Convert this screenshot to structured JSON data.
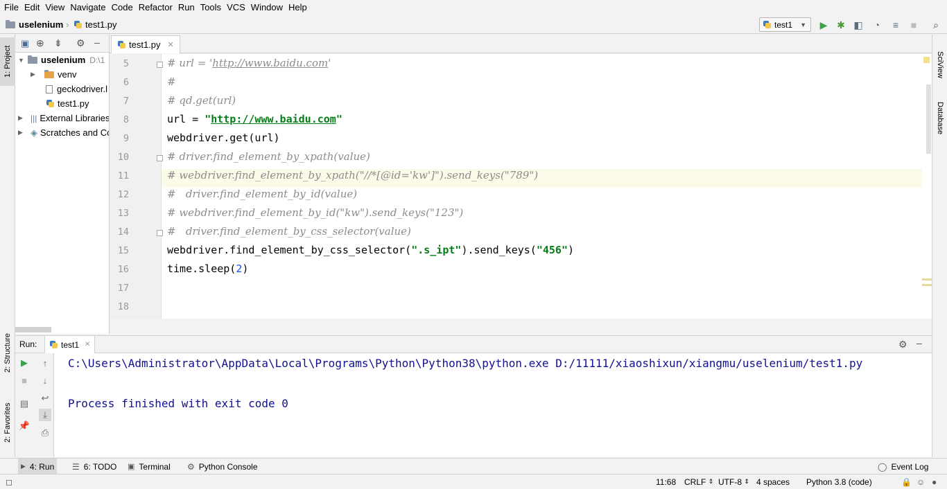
{
  "menu": [
    "File",
    "Edit",
    "View",
    "Navigate",
    "Code",
    "Refactor",
    "Run",
    "Tools",
    "VCS",
    "Window",
    "Help"
  ],
  "breadcrumb": {
    "project": "uselenium",
    "file": "test1.py"
  },
  "run_config": {
    "name": "test1"
  },
  "left_tabs": {
    "project": "1: Project",
    "structure": "2: Structure",
    "favorites": "2: Favorites"
  },
  "right_tabs": {
    "sciview": "SciView",
    "database": "Database"
  },
  "project_tree": {
    "root": "uselenium",
    "root_path": "D:\\1",
    "items": [
      {
        "label": "venv"
      },
      {
        "label": "geckodriver.l"
      },
      {
        "label": "test1.py"
      },
      {
        "label": "External Libraries"
      },
      {
        "label": "Scratches and Co"
      }
    ]
  },
  "editor": {
    "tab": "test1.py",
    "lines": [
      {
        "n": "5",
        "parts": [
          [
            "cmt",
            "# url = '"
          ],
          [
            "cmt-url",
            "http://www.baidu.com"
          ],
          [
            "cmt",
            "'"
          ]
        ]
      },
      {
        "n": "6",
        "parts": [
          [
            "cmt",
            "#"
          ]
        ]
      },
      {
        "n": "7",
        "parts": [
          [
            "cmt",
            "# qd.get(url)"
          ]
        ]
      },
      {
        "n": "8",
        "parts": [
          [
            "",
            "url = "
          ],
          [
            "str",
            "\""
          ],
          [
            "url",
            "http://www.baidu.com"
          ],
          [
            "str",
            "\""
          ]
        ]
      },
      {
        "n": "9",
        "parts": [
          [
            "",
            "webdriver.get(url)"
          ]
        ]
      },
      {
        "n": "10",
        "parts": [
          [
            "cmt",
            "# driver.find_element_by_xpath(value)"
          ]
        ]
      },
      {
        "n": "11",
        "parts": [
          [
            "cmt",
            "# webdriver.find_element_by_xpath(\"//*[@id='kw']\").send_keys(\"789\")"
          ]
        ]
      },
      {
        "n": "12",
        "parts": [
          [
            "cmt",
            "#   driver.find_element_by_id(value)"
          ]
        ]
      },
      {
        "n": "13",
        "parts": [
          [
            "cmt",
            "# webdriver.find_element_by_id(\"kw\").send_keys(\"123\")"
          ]
        ]
      },
      {
        "n": "14",
        "parts": [
          [
            "cmt",
            "#   driver.find_element_by_css_selector(value)"
          ]
        ]
      },
      {
        "n": "15",
        "parts": [
          [
            "",
            "webdriver.find_element_by_css_selector("
          ],
          [
            "str",
            "\".s_ipt\""
          ],
          [
            "",
            ").send_keys("
          ],
          [
            "str",
            "\"456\""
          ],
          [
            "",
            ")"
          ]
        ]
      },
      {
        "n": "16",
        "parts": [
          [
            "",
            "time.sleep("
          ],
          [
            "num",
            "2"
          ],
          [
            "",
            ")"
          ]
        ]
      },
      {
        "n": "17",
        "parts": []
      },
      {
        "n": "18",
        "parts": []
      }
    ]
  },
  "run_panel": {
    "label": "Run:",
    "tab": "test1",
    "output": [
      "C:\\Users\\Administrator\\AppData\\Local\\Programs\\Python\\Python38\\python.exe D:/11111/xiaoshixun/xiangmu/uselenium/test1.py",
      "",
      "Process finished with exit code 0"
    ]
  },
  "bottom_tabs": {
    "run": "4: Run",
    "todo": "6: TODO",
    "terminal": "Terminal",
    "console": "Python Console",
    "event_log": "Event Log"
  },
  "status": {
    "position": "11:68",
    "line_sep": "CRLF",
    "encoding": "UTF-8",
    "indent": "4 spaces",
    "interpreter": "Python 3.8 (code)"
  }
}
